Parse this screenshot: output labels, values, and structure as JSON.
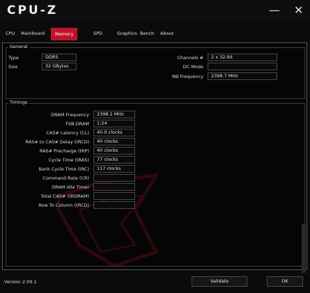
{
  "app": {
    "title": "CPU-Z",
    "minimize_glyph": "—",
    "close_glyph": "✕"
  },
  "tabs": [
    {
      "label": "CPU"
    },
    {
      "label": "Mainboard"
    },
    {
      "label": "Memory"
    },
    {
      "label": "SPD"
    },
    {
      "label": "Graphics"
    },
    {
      "label": "Bench"
    },
    {
      "label": "About"
    }
  ],
  "general": {
    "title": "General",
    "type_label": "Type",
    "type_value": "DDR5",
    "size_label": "Size",
    "size_value": "32 GBytes",
    "channels_label": "Channels #",
    "channels_value": "2 x 32-bit",
    "dcmode_label": "DC Mode",
    "dcmode_value": "",
    "nbfreq_label": "NB Frequency",
    "nbfreq_value": "2398.7 MHz"
  },
  "timings": {
    "title": "Timings",
    "rows": [
      {
        "label": "DRAM Frequency",
        "value": "2398.1 MHz"
      },
      {
        "label": "FSB:DRAM",
        "value": "1:24"
      },
      {
        "label": "CAS# Latency (CL)",
        "value": "40.0 clocks"
      },
      {
        "label": "RAS# to CAS# Delay (tRCD)",
        "value": "40 clocks"
      },
      {
        "label": "RAS# Precharge (tRP)",
        "value": "40 clocks"
      },
      {
        "label": "Cycle Time (tRAS)",
        "value": "77 clocks"
      },
      {
        "label": "Bank Cycle Time (tRC)",
        "value": "117 clocks"
      },
      {
        "label": "Command Rate (CR)",
        "value": ""
      },
      {
        "label": "DRAM Idle Timer",
        "value": ""
      },
      {
        "label": "Total CAS# (tRDRAM)",
        "value": ""
      },
      {
        "label": "Row To Column (tRCD)",
        "value": ""
      }
    ]
  },
  "footer": {
    "version": "Version 2.09.1",
    "validate": "Validate",
    "ok": "OK"
  },
  "colors": {
    "accent": "#c0132b",
    "background": "#0b0b0b",
    "border": "#4a4a4a"
  }
}
